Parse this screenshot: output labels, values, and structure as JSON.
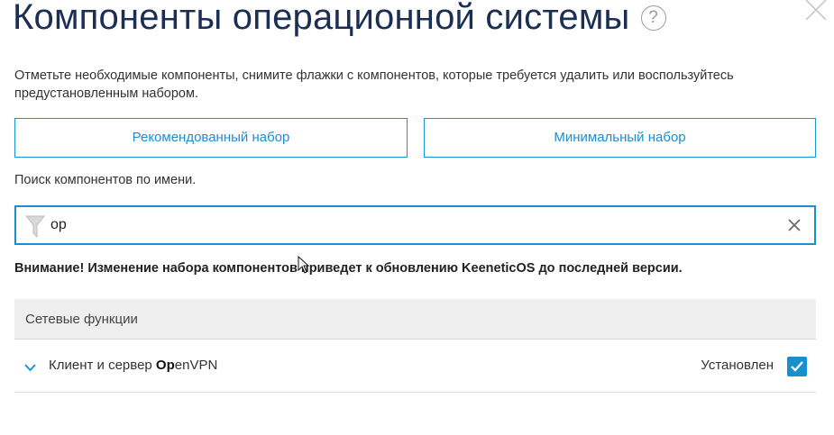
{
  "dialog": {
    "title": "Компоненты операционной системы",
    "help_icon": "?",
    "close_icon": "close-icon"
  },
  "intro_text": "Отметьте необходимые компоненты, снимите флажки с компонентов, которые требуется удалить или воспользуйтесь предустановленным набором.",
  "presets": {
    "recommended_label": "Рекомендованный набор",
    "minimal_label": "Минимальный набор"
  },
  "search": {
    "label": "Поиск компонентов по имени.",
    "value": "op",
    "filter_icon": "filter-icon",
    "clear_icon": "clear-icon"
  },
  "warning_text": "Внимание! Изменение набора компонентов приведет к обновлению KeeneticOS до последней версии.",
  "groups": [
    {
      "name": "Сетевые функции",
      "components": [
        {
          "name_prefix": "Клиент и сервер ",
          "name_match": "Op",
          "name_suffix": "enVPN",
          "status": "Установлен",
          "checked": true
        }
      ]
    }
  ],
  "colors": {
    "accent": "#1a8fd0",
    "title": "#1b2f55",
    "group_bg": "#efefef"
  }
}
